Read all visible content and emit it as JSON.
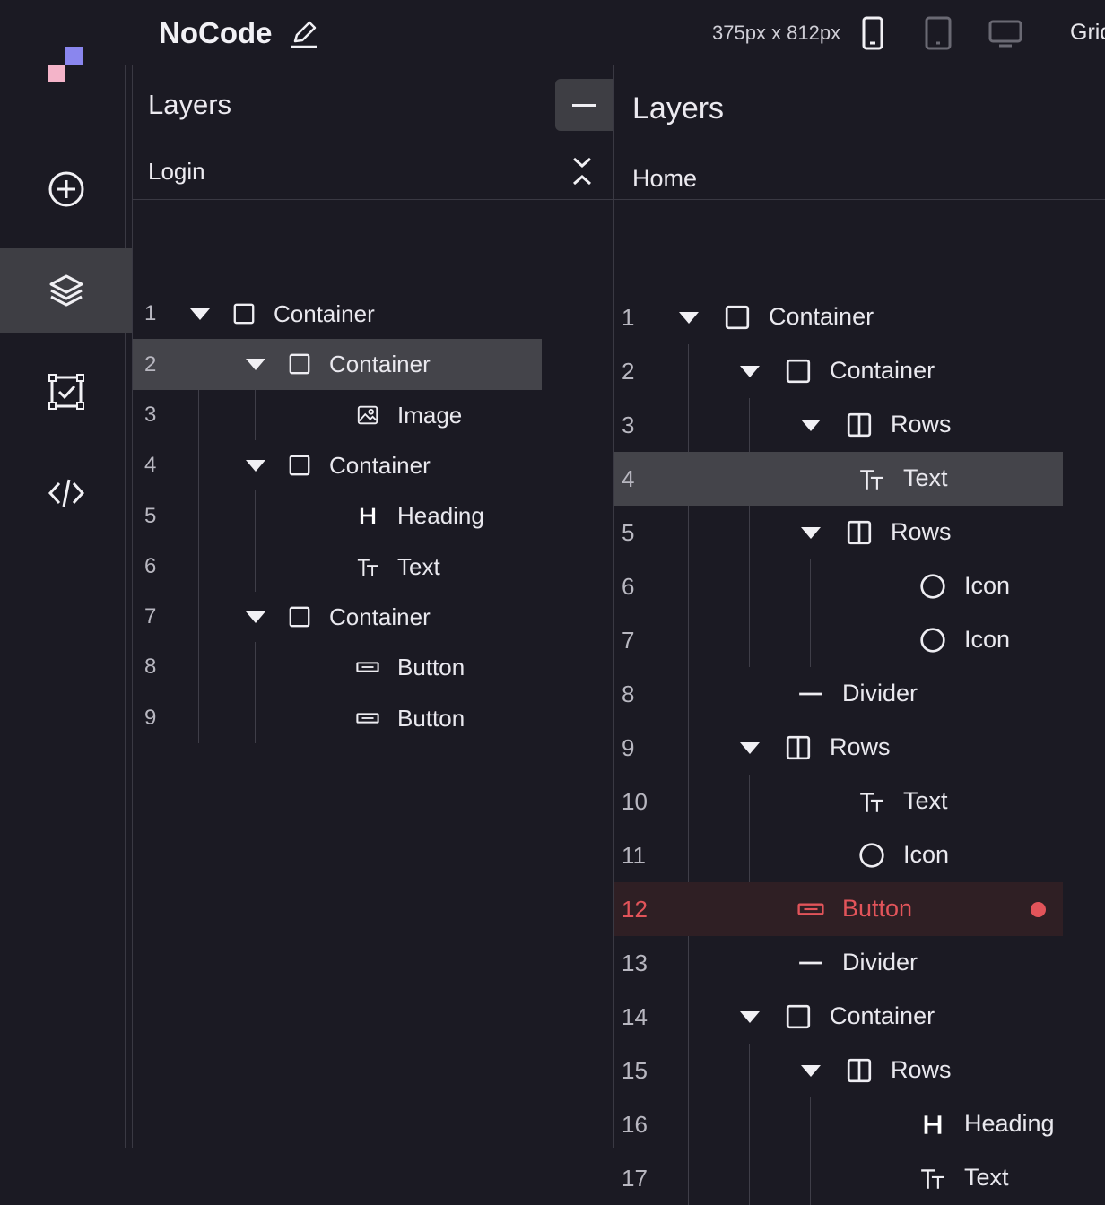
{
  "app": {
    "name": "NoCode",
    "viewport_label": "375px x 812px",
    "grid_label": "Grid"
  },
  "sidebar": {
    "items": [
      {
        "name": "add",
        "icon": "plus-circle-icon"
      },
      {
        "name": "layers",
        "icon": "layers-icon",
        "active": true
      },
      {
        "name": "checklist",
        "icon": "checkbox-frame-icon"
      },
      {
        "name": "code",
        "icon": "code-icon"
      }
    ]
  },
  "devices": [
    {
      "name": "mobile",
      "icon": "mobile-icon",
      "active": true
    },
    {
      "name": "tablet",
      "icon": "tablet-icon",
      "active": false
    },
    {
      "name": "desktop",
      "icon": "desktop-icon",
      "active": false
    }
  ],
  "colors": {
    "background": "#1b1a23",
    "selected_row": "#44444a",
    "error": "#e2545a",
    "logo_primary": "#8a86ee",
    "logo_secondary": "#f4b4c9"
  },
  "panels": [
    {
      "title": "Layers",
      "subtitle": "Login",
      "layers": [
        {
          "n": "1",
          "label": "Container",
          "icon": "container",
          "depth": 0,
          "expandable": true
        },
        {
          "n": "2",
          "label": "Container",
          "icon": "container",
          "depth": 1,
          "expandable": true,
          "selected": true
        },
        {
          "n": "3",
          "label": "Image",
          "icon": "image",
          "depth": 2
        },
        {
          "n": "4",
          "label": "Container",
          "icon": "container",
          "depth": 1,
          "expandable": true
        },
        {
          "n": "5",
          "label": "Heading",
          "icon": "heading",
          "depth": 2
        },
        {
          "n": "6",
          "label": "Text",
          "icon": "text",
          "depth": 2
        },
        {
          "n": "7",
          "label": "Container",
          "icon": "container",
          "depth": 1,
          "expandable": true
        },
        {
          "n": "8",
          "label": "Button",
          "icon": "button",
          "depth": 2
        },
        {
          "n": "9",
          "label": "Button",
          "icon": "button",
          "depth": 2
        }
      ]
    },
    {
      "title": "Layers",
      "subtitle": "Home",
      "layers": [
        {
          "n": "1",
          "label": "Container",
          "icon": "container",
          "depth": 0,
          "expandable": true
        },
        {
          "n": "2",
          "label": "Container",
          "icon": "container",
          "depth": 1,
          "expandable": true
        },
        {
          "n": "3",
          "label": "Rows",
          "icon": "rows",
          "depth": 2,
          "expandable": true
        },
        {
          "n": "4",
          "label": "Text",
          "icon": "text",
          "depth": 2,
          "selected": true
        },
        {
          "n": "5",
          "label": "Rows",
          "icon": "rows",
          "depth": 2,
          "expandable": true
        },
        {
          "n": "6",
          "label": "Icon",
          "icon": "circle",
          "depth": 3
        },
        {
          "n": "7",
          "label": "Icon",
          "icon": "circle",
          "depth": 3
        },
        {
          "n": "8",
          "label": "Divider",
          "icon": "divider",
          "depth": 1
        },
        {
          "n": "9",
          "label": "Rows",
          "icon": "rows",
          "depth": 1,
          "expandable": true
        },
        {
          "n": "10",
          "label": "Text",
          "icon": "text",
          "depth": 2
        },
        {
          "n": "11",
          "label": "Icon",
          "icon": "circle",
          "depth": 2
        },
        {
          "n": "12",
          "label": "Button",
          "icon": "button",
          "depth": 1,
          "error": true
        },
        {
          "n": "13",
          "label": "Divider",
          "icon": "divider",
          "depth": 1
        },
        {
          "n": "14",
          "label": "Container",
          "icon": "container",
          "depth": 1,
          "expandable": true
        },
        {
          "n": "15",
          "label": "Rows",
          "icon": "rows",
          "depth": 2,
          "expandable": true
        },
        {
          "n": "16",
          "label": "Heading",
          "icon": "heading",
          "depth": 3
        },
        {
          "n": "17",
          "label": "Text",
          "icon": "text",
          "depth": 3
        }
      ]
    }
  ]
}
